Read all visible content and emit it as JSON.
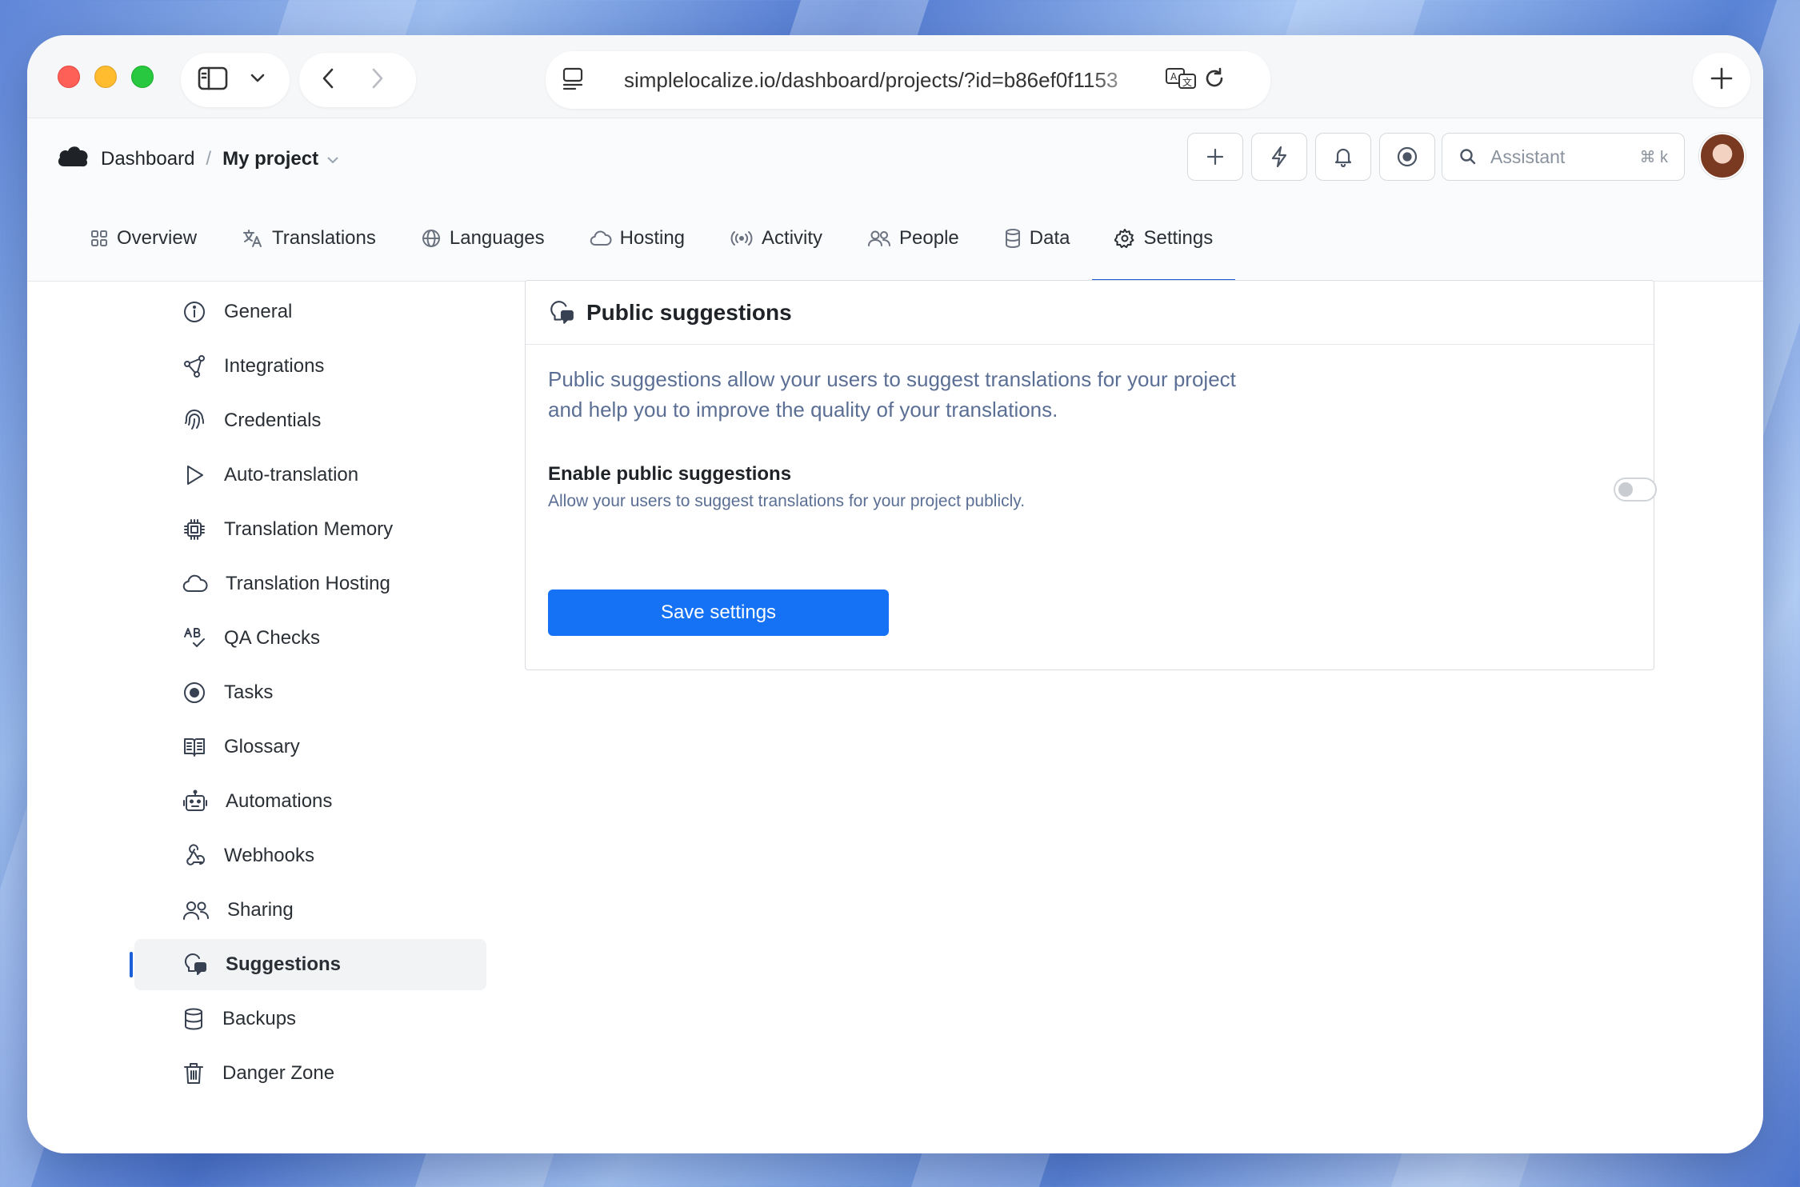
{
  "browser": {
    "url": "simplelocalize.io/dashboard/projects/?id=b86ef0f1153"
  },
  "breadcrumb": {
    "root": "Dashboard",
    "separator": "/",
    "project": "My project"
  },
  "header": {
    "search_placeholder": "Assistant",
    "search_shortcut": "⌘ k"
  },
  "tabs": [
    {
      "label": "Overview",
      "icon": "grid-icon"
    },
    {
      "label": "Translations",
      "icon": "translate-icon"
    },
    {
      "label": "Languages",
      "icon": "globe-icon"
    },
    {
      "label": "Hosting",
      "icon": "cloud-icon"
    },
    {
      "label": "Activity",
      "icon": "broadcast-icon"
    },
    {
      "label": "People",
      "icon": "users-icon"
    },
    {
      "label": "Data",
      "icon": "database-icon"
    },
    {
      "label": "Settings",
      "icon": "gear-icon",
      "active": true
    }
  ],
  "sidebar": {
    "items": [
      {
        "label": "General",
        "icon": "info-icon"
      },
      {
        "label": "Integrations",
        "icon": "share-nodes-icon"
      },
      {
        "label": "Credentials",
        "icon": "fingerprint-icon"
      },
      {
        "label": "Auto-translation",
        "icon": "play-icon"
      },
      {
        "label": "Translation Memory",
        "icon": "chip-icon"
      },
      {
        "label": "Translation Hosting",
        "icon": "cloud-icon"
      },
      {
        "label": "QA Checks",
        "icon": "spellcheck-icon"
      },
      {
        "label": "Tasks",
        "icon": "target-icon"
      },
      {
        "label": "Glossary",
        "icon": "book-icon"
      },
      {
        "label": "Automations",
        "icon": "robot-icon"
      },
      {
        "label": "Webhooks",
        "icon": "webhook-icon"
      },
      {
        "label": "Sharing",
        "icon": "users-icon"
      },
      {
        "label": "Suggestions",
        "icon": "suggestion-icon",
        "active": true
      },
      {
        "label": "Backups",
        "icon": "database-icon"
      },
      {
        "label": "Danger Zone",
        "icon": "trash-icon"
      }
    ]
  },
  "panel": {
    "title": "Public suggestions",
    "description": "Public suggestions allow your users to suggest translations for your project and help you to improve the quality of your translations.",
    "option_title": "Enable public suggestions",
    "option_subtitle": "Allow your users to suggest translations for your project publicly.",
    "option_enabled": false,
    "save_label": "Save settings"
  },
  "colors": {
    "accent": "#1672f5",
    "tab_underline": "#1a5fd8",
    "muted_text": "#5b6f95"
  }
}
